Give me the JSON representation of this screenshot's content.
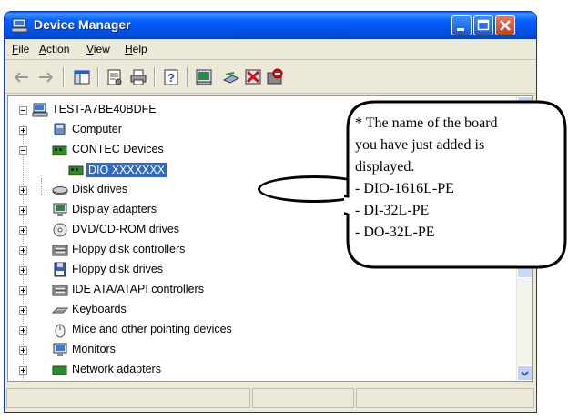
{
  "window": {
    "title": "Device Manager",
    "buttons": [
      "minimize",
      "maximize",
      "close"
    ]
  },
  "menu": [
    {
      "label": "File",
      "underline": "F",
      "rest": "ile"
    },
    {
      "label": "Action",
      "underline": "A",
      "rest": "ction"
    },
    {
      "label": "View",
      "underline": "V",
      "rest": "iew"
    },
    {
      "label": "Help",
      "underline": "H",
      "rest": "elp"
    }
  ],
  "toolbar_icons": [
    "back-arrow-icon",
    "forward-arrow-icon",
    "show-hide-console-tree-icon",
    "properties-icon",
    "print-icon",
    "help-icon",
    "scan-hardware-icon",
    "update-driver-icon",
    "uninstall-icon",
    "disable-icon"
  ],
  "tree": {
    "root": "TEST-A7BE40BDFE",
    "items": [
      {
        "label": "Computer",
        "icon": "computer-icon",
        "state": "collapsed"
      },
      {
        "label": "CONTEC Devices",
        "icon": "board-icon",
        "state": "expanded"
      },
      {
        "label": "DIO  XXXXXXX",
        "icon": "board-icon",
        "state": "leaf",
        "selected": true
      },
      {
        "label": "Disk drives",
        "icon": "disk-drive-icon",
        "state": "collapsed"
      },
      {
        "label": "Display adapters",
        "icon": "display-adapter-icon",
        "state": "collapsed"
      },
      {
        "label": "DVD/CD-ROM drives",
        "icon": "cdrom-icon",
        "state": "collapsed"
      },
      {
        "label": "Floppy disk controllers",
        "icon": "controller-icon",
        "state": "collapsed"
      },
      {
        "label": "Floppy disk drives",
        "icon": "floppy-icon",
        "state": "collapsed"
      },
      {
        "label": "IDE ATA/ATAPI controllers",
        "icon": "controller-icon",
        "state": "collapsed"
      },
      {
        "label": "Keyboards",
        "icon": "keyboard-icon",
        "state": "collapsed"
      },
      {
        "label": "Mice and other pointing devices",
        "icon": "mouse-icon",
        "state": "collapsed"
      },
      {
        "label": "Monitors",
        "icon": "monitor-icon",
        "state": "collapsed"
      },
      {
        "label": "Network adapters",
        "icon": "network-icon",
        "state": "collapsed"
      }
    ]
  },
  "callout": {
    "lines": [
      "* The name of the board",
      "you have just added is",
      "displayed.",
      "- DIO-1616L-PE",
      "- DI-32L-PE",
      "- DO-32L-PE"
    ]
  },
  "colors": {
    "titlebar": "#0053e6",
    "selection": "#316ac5",
    "window_face": "#ece9d8"
  }
}
